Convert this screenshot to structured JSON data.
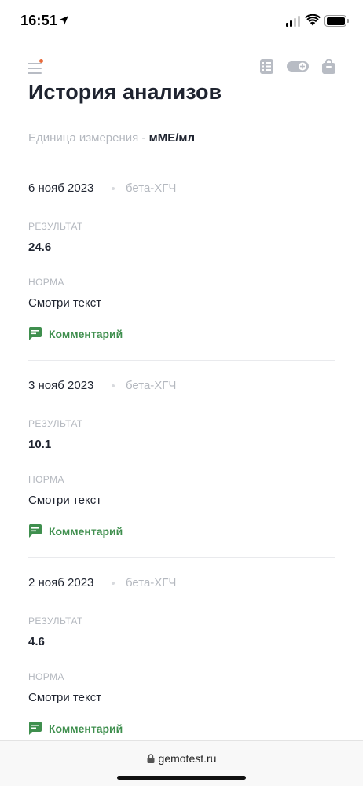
{
  "status_bar": {
    "time": "16:51"
  },
  "page": {
    "title": "История анализов",
    "units_label": "Единица измерения - ",
    "units_value": "мМЕ/мл"
  },
  "labels": {
    "result": "РЕЗУЛЬТАТ",
    "norm": "НОРМА",
    "comment": "Комментарий"
  },
  "records": [
    {
      "date": "6 нояб 2023",
      "test": "бета-ХГЧ",
      "result": "24.6",
      "norm": "Смотри текст"
    },
    {
      "date": "3 нояб 2023",
      "test": "бета-ХГЧ",
      "result": "10.1",
      "norm": "Смотри текст"
    },
    {
      "date": "2 нояб 2023",
      "test": "бета-ХГЧ",
      "result": "4.6",
      "norm": "Смотри текст"
    }
  ],
  "browser": {
    "url": "gemotest.ru"
  },
  "icons": [
    "menu-icon",
    "list-icon",
    "toggle-icon",
    "bag-icon",
    "comment-icon",
    "lock-icon",
    "location-arrow-icon",
    "signal-icon",
    "wifi-icon",
    "battery-icon"
  ],
  "colors": {
    "accent_green": "#3f8f4e",
    "notification_dot": "#e86a3a",
    "muted_text": "#b4b8bf",
    "text": "#1f2430"
  }
}
